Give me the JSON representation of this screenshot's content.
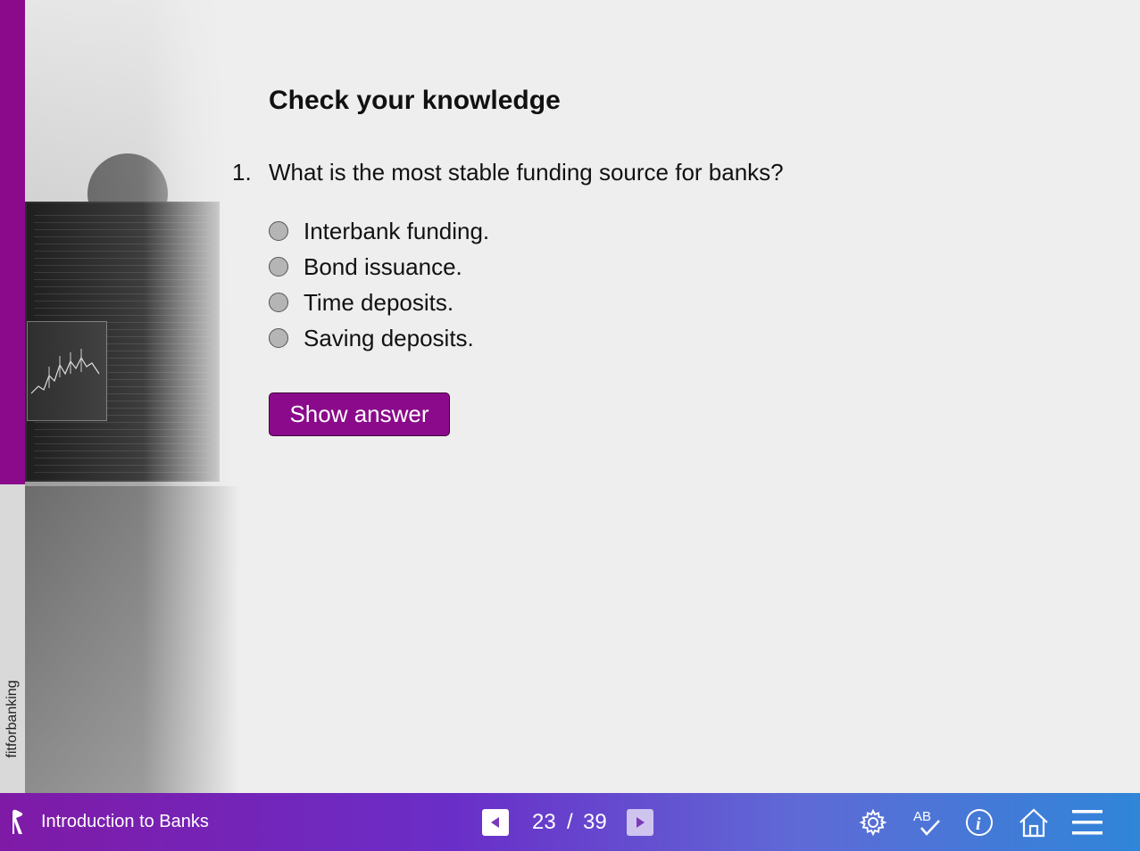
{
  "brand": {
    "vertical_text": "fitforbanking"
  },
  "content": {
    "title": "Check your knowledge",
    "question": {
      "number": "1.",
      "text": "What is the most stable funding source for banks?"
    },
    "options": [
      {
        "label": "Interbank funding."
      },
      {
        "label": "Bond issuance."
      },
      {
        "label": "Time deposits."
      },
      {
        "label": "Saving deposits."
      }
    ],
    "show_answer_label": "Show answer"
  },
  "footer": {
    "course_title": "Introduction to Banks",
    "page_current": "23",
    "page_separator": "/",
    "page_total": "39",
    "prev_icon": "triangle-left-icon",
    "next_icon": "triangle-right-icon",
    "tools": [
      "gear-icon",
      "spellcheck-icon",
      "info-icon",
      "home-icon",
      "hamburger-menu-icon"
    ]
  },
  "colors": {
    "accent": "#8b0a8b",
    "footer_start": "#7f1aa6",
    "footer_end": "#2f86d8"
  }
}
